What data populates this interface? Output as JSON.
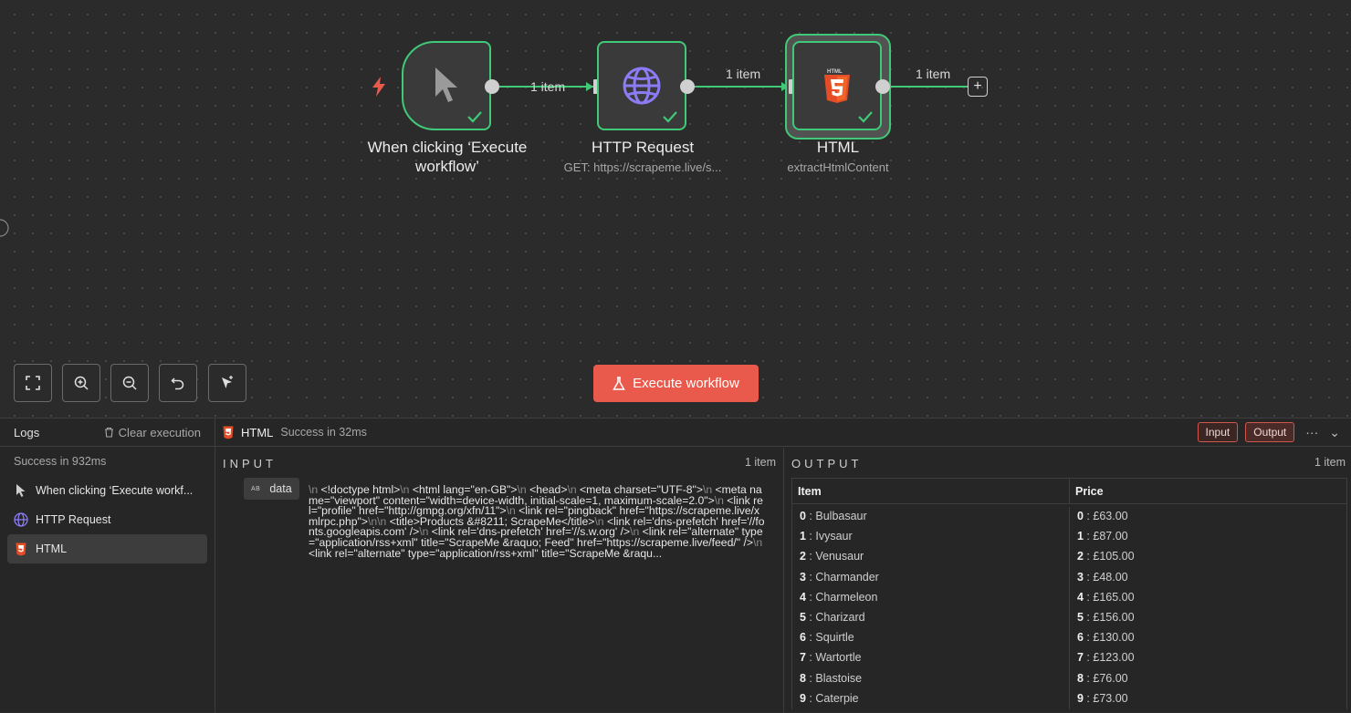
{
  "canvas": {
    "nodes": [
      {
        "title_line1": "When clicking ‘Execute",
        "title_line2": "workflow’",
        "icon": "cursor-icon"
      },
      {
        "title": "HTTP Request",
        "subtitle": "GET: https://scrapeme.live/s...",
        "icon": "globe-icon"
      },
      {
        "title": "HTML",
        "subtitle": "extractHtmlContent",
        "icon": "html5-icon"
      }
    ],
    "edges": [
      "1 item",
      "1 item",
      "1 item"
    ],
    "plus": "+"
  },
  "toolbar": {
    "execute_label": "Execute workflow"
  },
  "logs": {
    "title": "Logs",
    "clear_label": "Clear execution",
    "status": "Success in 932ms",
    "items": [
      {
        "label": "When clicking ‘Execute workf...",
        "icon": "cursor-icon"
      },
      {
        "label": "HTTP Request",
        "icon": "globe-icon"
      },
      {
        "label": "HTML",
        "icon": "html5-icon",
        "active": true
      }
    ]
  },
  "run": {
    "node_name": "HTML",
    "status": "Success in 32ms",
    "input_label": "Input",
    "output_label": "Output",
    "more": "···",
    "collapse": "⌄"
  },
  "input": {
    "title": "INPUT",
    "count": "1 item",
    "key": "data",
    "key_type": "AB",
    "value_html": "<span class='nl'>\\n</span> &lt;!doctype html&gt;<span class='nl'>\\n</span> &lt;html lang=\"en-GB\"&gt;<span class='nl'>\\n</span> &lt;head&gt;<span class='nl'>\\n</span> &lt;meta charset=\"UTF-8\"&gt;<span class='nl'>\\n</span> &lt;meta name=\"viewport\" content=\"width=device-width, initial-scale=1, maximum-scale=2.0\"&gt;<span class='nl'>\\n</span> &lt;link rel=\"profile\" href=\"http://gmpg.org/xfn/11\"&gt;<span class='nl'>\\n</span> &lt;link rel=\"pingback\" href=\"https://scrapeme.live/xmlrpc.php\"&gt;<span class='nl'>\\n</span><span class='nl'>\\n</span> &lt;title&gt;Products &amp;#8211; ScrapeMe&lt;/title&gt;<span class='nl'>\\n</span> &lt;link rel='dns-prefetch' href='//fonts.googleapis.com' /&gt;<span class='nl'>\\n</span> &lt;link rel='dns-prefetch' href='//s.w.org' /&gt;<span class='nl'>\\n</span> &lt;link rel=\"alternate\" type=\"application/rss+xml\" title=\"ScrapeMe &amp;raquo; Feed\" href=\"https://scrapeme.live/feed/\" /&gt;<span class='nl'>\\n</span> &lt;link rel=\"alternate\" type=\"application/rss+xml\" title=\"ScrapeMe &amp;raqu..."
  },
  "output": {
    "title": "OUTPUT",
    "count": "1 item",
    "columns": [
      "Item",
      "Price"
    ],
    "items": [
      "Bulbasaur",
      "Ivysaur",
      "Venusaur",
      "Charmander",
      "Charmeleon",
      "Charizard",
      "Squirtle",
      "Wartortle",
      "Blastoise",
      "Caterpie"
    ],
    "prices": [
      "£63.00",
      "£87.00",
      "£105.00",
      "£48.00",
      "£165.00",
      "£156.00",
      "£130.00",
      "£123.00",
      "£76.00",
      "£73.00"
    ]
  },
  "colors": {
    "success_green": "#40c977",
    "execute_red": "#ea5a4c",
    "html5_orange": "#e44d26",
    "globe_purple": "#8b7cf6"
  }
}
